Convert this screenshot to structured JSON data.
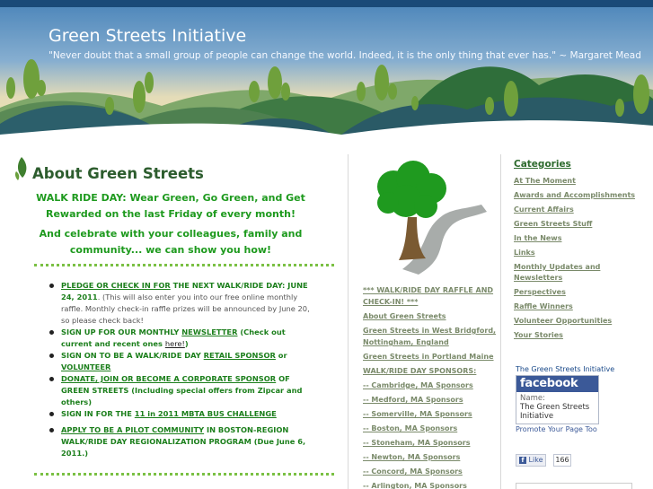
{
  "header": {
    "site_title": "Green Streets Initiative",
    "quote": "\"Never doubt that a small group of people can change the world. Indeed, it is the only thing that ever has.\" ~ Margaret Mead"
  },
  "main": {
    "title": "About Green Streets",
    "promo1": "WALK RIDE DAY: Wear Green, Go Green, and Get Rewarded on the last Friday of every month!",
    "promo2": "And celebrate with your colleagues, family and community... we can show you how!",
    "news": {
      "item1_link": "PLEDGE OR CHECK IN FOR",
      "item1_bold": " THE NEXT WALK/RIDE DAY: JUNE 24, 2011",
      "item1_text": ". (This will also enter you into our free online monthly raffle. Monthly check-in raffle prizes will be announced by June 20, so please check back!",
      "item2_bold": "SIGN UP FOR OUR MONTHLY ",
      "item2_link": "NEWSLETTER",
      "item2_text1": " (Check out current and recent ones ",
      "item2_here": "here!",
      "item2_text2": ")",
      "item3_bold": "SIGN ON TO BE A WALK/RIDE DAY ",
      "item3_link1": "RETAIL SPONSOR",
      "item3_or": " or ",
      "item3_link2": "VOLUNTEER ",
      "item4_link": " DONATE, JOIN OR BECOME A CORPORATE SPONSOR",
      "item4_bold": " OF GREEN STREETS (Including special offers from Zipcar and others)",
      "item5_bold": "SIGN IN FOR THE ",
      "item5_link": "11 in 2011 MBTA BUS CHALLENGE",
      "item6_link": "APPLY TO BE A PILOT COMMUNITY",
      "item6_bold": " IN BOSTON-REGION WALK/RIDE DAY REGIONALIZATION PROGRAM (Due June 6, 2011.)"
    }
  },
  "middle": {
    "links": [
      "*** WALK/RIDE DAY RAFFLE AND CHECK-IN! ***",
      "About Green Streets",
      "Green Streets in West Bridgford, Nottingham, England",
      "Green Streets in Portland Maine",
      "WALK/RIDE DAY SPONSORS:",
      "-- Cambridge, MA Sponsors",
      "-- Medford, MA Sponsors",
      "-- Somerville, MA Sponsors",
      "-- Boston, MA Sponsors",
      "-- Stoneham, MA Sponsors",
      "-- Newton, MA Sponsors",
      "-- Concord, MA Sponsors",
      "-- Arlington, MA Sponsors"
    ]
  },
  "right": {
    "categories_title": "Categories",
    "categories": [
      "At The Moment",
      "Awards and Accomplishments",
      "Current Affairs",
      "Green Streets Stuff",
      "In the News",
      "Links",
      "Monthly Updates and Newsletters",
      "Perspectives",
      "Raffle Winners",
      "Volunteer Opportunities",
      "Your Stories"
    ],
    "facebook": {
      "heading": "The Green Streets Initiative",
      "logo": "facebook",
      "name_label": "Name:",
      "name_value": "The Green Streets Initiative",
      "promote": "Promote Your Page Too",
      "like_label": "Like",
      "like_count": "166"
    }
  },
  "colors": {
    "title_green": "#2d5d2e",
    "promo_green": "#1e9a1e",
    "link_green": "#1c7f1c",
    "facebook_blue": "#3b5998"
  }
}
